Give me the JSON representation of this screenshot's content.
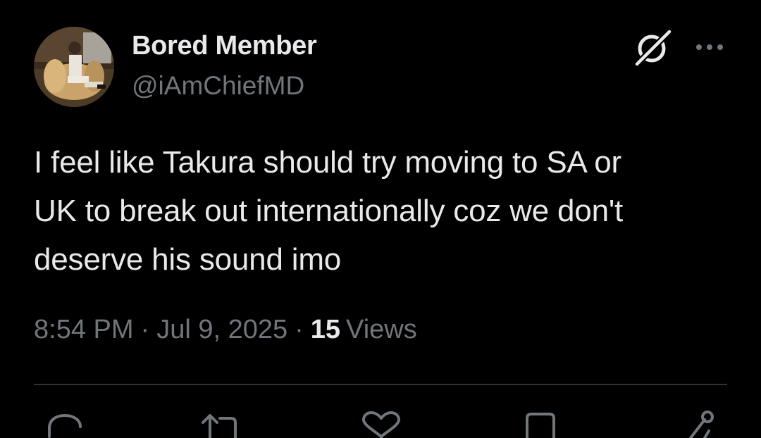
{
  "user": {
    "display_name": "Bored Member",
    "handle": "@iAmChiefMD"
  },
  "tweet": {
    "text_lines": [
      "I feel like Takura should try moving to SA or",
      "UK to break out internationally coz we don't",
      "deserve his sound imo"
    ],
    "time": "8:54 PM",
    "separator": "·",
    "date": "Jul 9, 2025",
    "views_count": "15",
    "views_label": "Views"
  },
  "icons": {
    "grok": "grok-icon",
    "more": "more-options-icon",
    "reply": "reply-icon",
    "retweet": "retweet-icon",
    "like": "like-icon",
    "bookmark": "bookmark-icon",
    "share": "share-icon"
  },
  "colors": {
    "background": "#000000",
    "primary_text": "#e7e9ea",
    "secondary_text": "#71767b",
    "divider": "#2f3336"
  }
}
